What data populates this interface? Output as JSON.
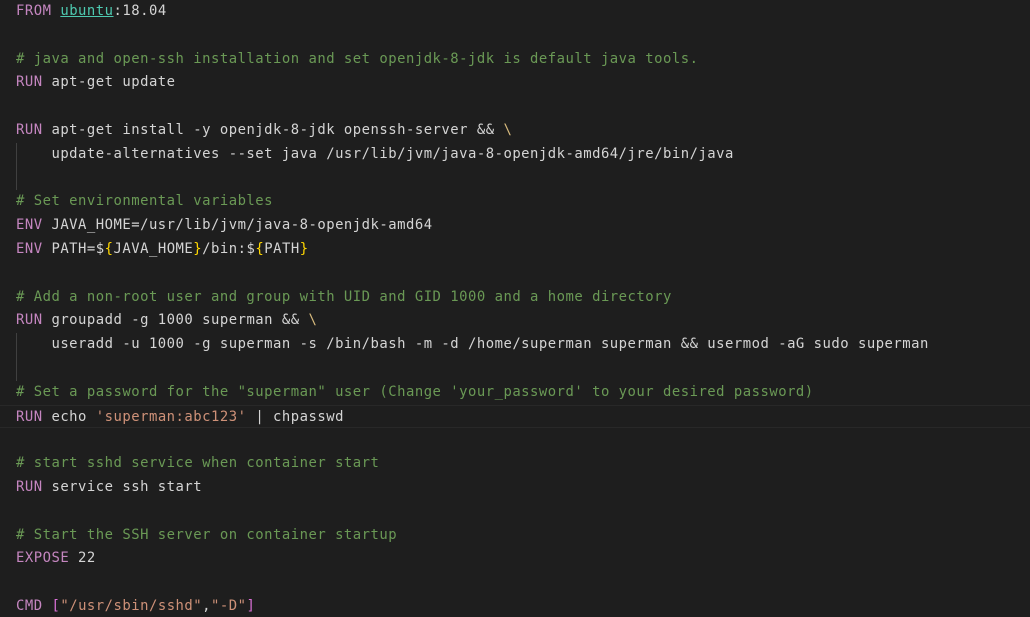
{
  "colors": {
    "background": "#1e1e1e",
    "keyword": "#c586c0",
    "comment": "#6a9955",
    "string": "#ce9178",
    "text": "#d4d4d4",
    "brace": "#ffd700",
    "bracket": "#da70d6",
    "image": "#4ec9b0"
  },
  "lines": [
    {
      "tokens": [
        {
          "t": "FROM",
          "c": "kw"
        },
        {
          "t": " "
        },
        {
          "t": "ubuntu",
          "c": "img"
        },
        {
          "t": ":18.04"
        }
      ]
    },
    {
      "tokens": []
    },
    {
      "tokens": [
        {
          "t": "# java and open-ssh installation and set openjdk-8-jdk is default java tools.",
          "c": "cm"
        }
      ]
    },
    {
      "tokens": [
        {
          "t": "RUN",
          "c": "kw"
        },
        {
          "t": " apt-get update"
        }
      ]
    },
    {
      "tokens": []
    },
    {
      "tokens": [
        {
          "t": "RUN",
          "c": "kw"
        },
        {
          "t": " apt-get install -y openjdk-8-jdk openssh-server && "
        },
        {
          "t": "\\",
          "c": "esc"
        }
      ]
    },
    {
      "tokens": [
        {
          "t": "    update-alternatives --set java /usr/lib/jvm/java-8-openjdk-amd64/jre/bin/java"
        }
      ]
    },
    {
      "tokens": []
    },
    {
      "tokens": [
        {
          "t": "# Set environmental variables",
          "c": "cm"
        }
      ]
    },
    {
      "tokens": [
        {
          "t": "ENV",
          "c": "kw"
        },
        {
          "t": " JAVA_HOME=/usr/lib/jvm/java-8-openjdk-amd64"
        }
      ]
    },
    {
      "tokens": [
        {
          "t": "ENV",
          "c": "kw"
        },
        {
          "t": " PATH=$"
        },
        {
          "t": "{",
          "c": "brace"
        },
        {
          "t": "JAVA_HOME"
        },
        {
          "t": "}",
          "c": "brace"
        },
        {
          "t": "/bin:$"
        },
        {
          "t": "{",
          "c": "brace"
        },
        {
          "t": "PATH"
        },
        {
          "t": "}",
          "c": "brace"
        }
      ]
    },
    {
      "tokens": []
    },
    {
      "tokens": [
        {
          "t": "# Add a non-root user and group with UID and GID 1000 and a home directory",
          "c": "cm"
        }
      ]
    },
    {
      "tokens": [
        {
          "t": "RUN",
          "c": "kw"
        },
        {
          "t": " groupadd -g 1000 superman && "
        },
        {
          "t": "\\",
          "c": "esc"
        }
      ]
    },
    {
      "tokens": [
        {
          "t": "    useradd -u 1000 -g superman -s /bin/bash -m -d /home/superman superman && usermod -aG sudo superman"
        }
      ]
    },
    {
      "tokens": []
    },
    {
      "tokens": [
        {
          "t": "# Set a password for the \"superman\" user (Change 'your_password' to your desired password)",
          "c": "cm"
        }
      ]
    },
    {
      "tokens": [
        {
          "t": "RUN",
          "c": "kw"
        },
        {
          "t": " echo "
        },
        {
          "t": "'superman:abc123'",
          "c": "str"
        },
        {
          "t": " | chpasswd"
        }
      ],
      "current": true
    },
    {
      "tokens": []
    },
    {
      "tokens": [
        {
          "t": "# start sshd service when container start",
          "c": "cm"
        }
      ]
    },
    {
      "tokens": [
        {
          "t": "RUN",
          "c": "kw"
        },
        {
          "t": " service ssh start"
        }
      ]
    },
    {
      "tokens": []
    },
    {
      "tokens": [
        {
          "t": "# Start the SSH server on container startup",
          "c": "cm"
        }
      ]
    },
    {
      "tokens": [
        {
          "t": "EXPOSE",
          "c": "kw"
        },
        {
          "t": " 22"
        }
      ]
    },
    {
      "tokens": []
    },
    {
      "tokens": [
        {
          "t": "CMD",
          "c": "kw"
        },
        {
          "t": " "
        },
        {
          "t": "[",
          "c": "bracket"
        },
        {
          "t": "\"/usr/sbin/sshd\"",
          "c": "str"
        },
        {
          "t": ","
        },
        {
          "t": "\"-D\"",
          "c": "str"
        },
        {
          "t": "]",
          "c": "bracket"
        }
      ]
    }
  ]
}
